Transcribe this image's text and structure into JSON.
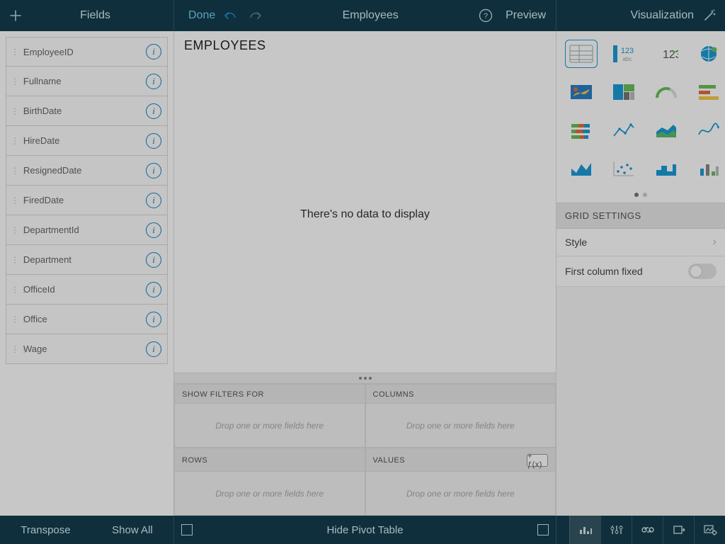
{
  "topbar": {
    "fields_label": "Fields",
    "done_label": "Done",
    "title": "Employees",
    "preview_label": "Preview",
    "visualization_label": "Visualization"
  },
  "fields": [
    {
      "name": "EmployeeID"
    },
    {
      "name": "Fullname"
    },
    {
      "name": "BirthDate"
    },
    {
      "name": "HireDate"
    },
    {
      "name": "ResignedDate"
    },
    {
      "name": "FiredDate"
    },
    {
      "name": "DepartmentId"
    },
    {
      "name": "Department"
    },
    {
      "name": "OfficeId"
    },
    {
      "name": "Office"
    },
    {
      "name": "Wage"
    }
  ],
  "main": {
    "heading": "EMPLOYEES",
    "empty_message": "There's no data to display"
  },
  "pivot": {
    "filters_label": "SHOW FILTERS FOR",
    "columns_label": "COLUMNS",
    "rows_label": "ROWS",
    "values_label": "VALUES",
    "drop_hint": "Drop one or more fields here",
    "fx_label": "+ ƒ(x)"
  },
  "viz": {
    "selected_index": 0,
    "text_123": "123",
    "settings_heading": "GRID SETTINGS",
    "style_label": "Style",
    "first_col_fixed_label": "First column fixed",
    "first_col_fixed_on": false
  },
  "bottombar": {
    "transpose_label": "Transpose",
    "showall_label": "Show All",
    "hide_pivot_label": "Hide Pivot Table"
  }
}
